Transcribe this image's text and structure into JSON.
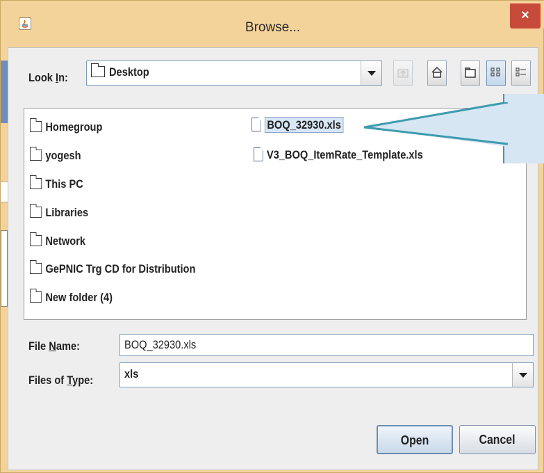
{
  "window": {
    "title": "Browse...",
    "close_label": "×"
  },
  "look_in": {
    "label_pre": "Look ",
    "label_mnemonic": "I",
    "label_post": "n:",
    "value": "Desktop"
  },
  "toolbar": {
    "icons": [
      "up-folder-icon",
      "home-icon",
      "new-folder-icon",
      "list-view-icon",
      "details-view-icon"
    ]
  },
  "folders": [
    "Homegroup",
    "yogesh",
    "This PC",
    "Libraries",
    "Network",
    "GePNIC Trg CD for Distribution",
    "New folder (4)"
  ],
  "files": [
    "BOQ_32930.xls",
    "V3_BOQ_ItemRate_Template.xls"
  ],
  "selected_file": "BOQ_32930.xls",
  "file_name": {
    "label_pre": "File ",
    "label_mnemonic": "N",
    "label_post": "ame:",
    "value": "BOQ_32930.xls"
  },
  "files_of_type": {
    "label_pre": "Files of ",
    "label_mnemonic": "T",
    "label_post": "ype:",
    "value": "xls"
  },
  "buttons": {
    "open": "Open",
    "cancel": "Cancel"
  },
  "colors": {
    "frame": "#f4d39a",
    "close": "#c74a3a",
    "selection": "#d8e6f5",
    "callout": "#3e9bb0"
  }
}
